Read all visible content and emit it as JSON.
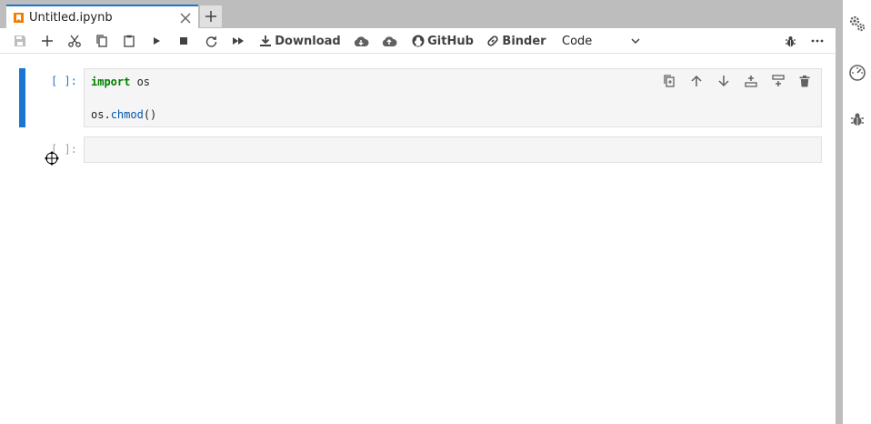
{
  "tabs": [
    {
      "label": "Untitled.ipynb",
      "icon": "notebook-icon",
      "active": true
    }
  ],
  "toolbar": {
    "download_label": "Download",
    "github_label": "GitHub",
    "binder_label": "Binder",
    "cell_type": "Code",
    "buttons": [
      "save-icon",
      "add-icon",
      "cut-icon",
      "copy-icon",
      "paste-icon",
      "run-icon",
      "stop-icon",
      "restart-icon",
      "run-all-icon",
      "download-icon",
      "cloud-download-icon",
      "cloud-upload-icon",
      "github-icon",
      "binder-icon",
      "bug-icon",
      "more-icon"
    ]
  },
  "cells": [
    {
      "prompt": "[ ]:",
      "lines": [
        "import os",
        "",
        "os.chmod()"
      ],
      "active": true
    },
    {
      "prompt": "[ ]:",
      "lines": [
        ""
      ],
      "active": false
    }
  ],
  "cell_tools": [
    "duplicate-icon",
    "move-up-icon",
    "move-down-icon",
    "insert-above-icon",
    "insert-below-icon",
    "delete-icon"
  ],
  "sidebar": [
    "property-inspector-icon",
    "debugger-speed-icon",
    "debugger-bug-icon"
  ],
  "colors": {
    "accent": "#1976d2",
    "keyword": "#008000",
    "function": "#0055aa",
    "tab_bar": "#bdbdbd"
  }
}
